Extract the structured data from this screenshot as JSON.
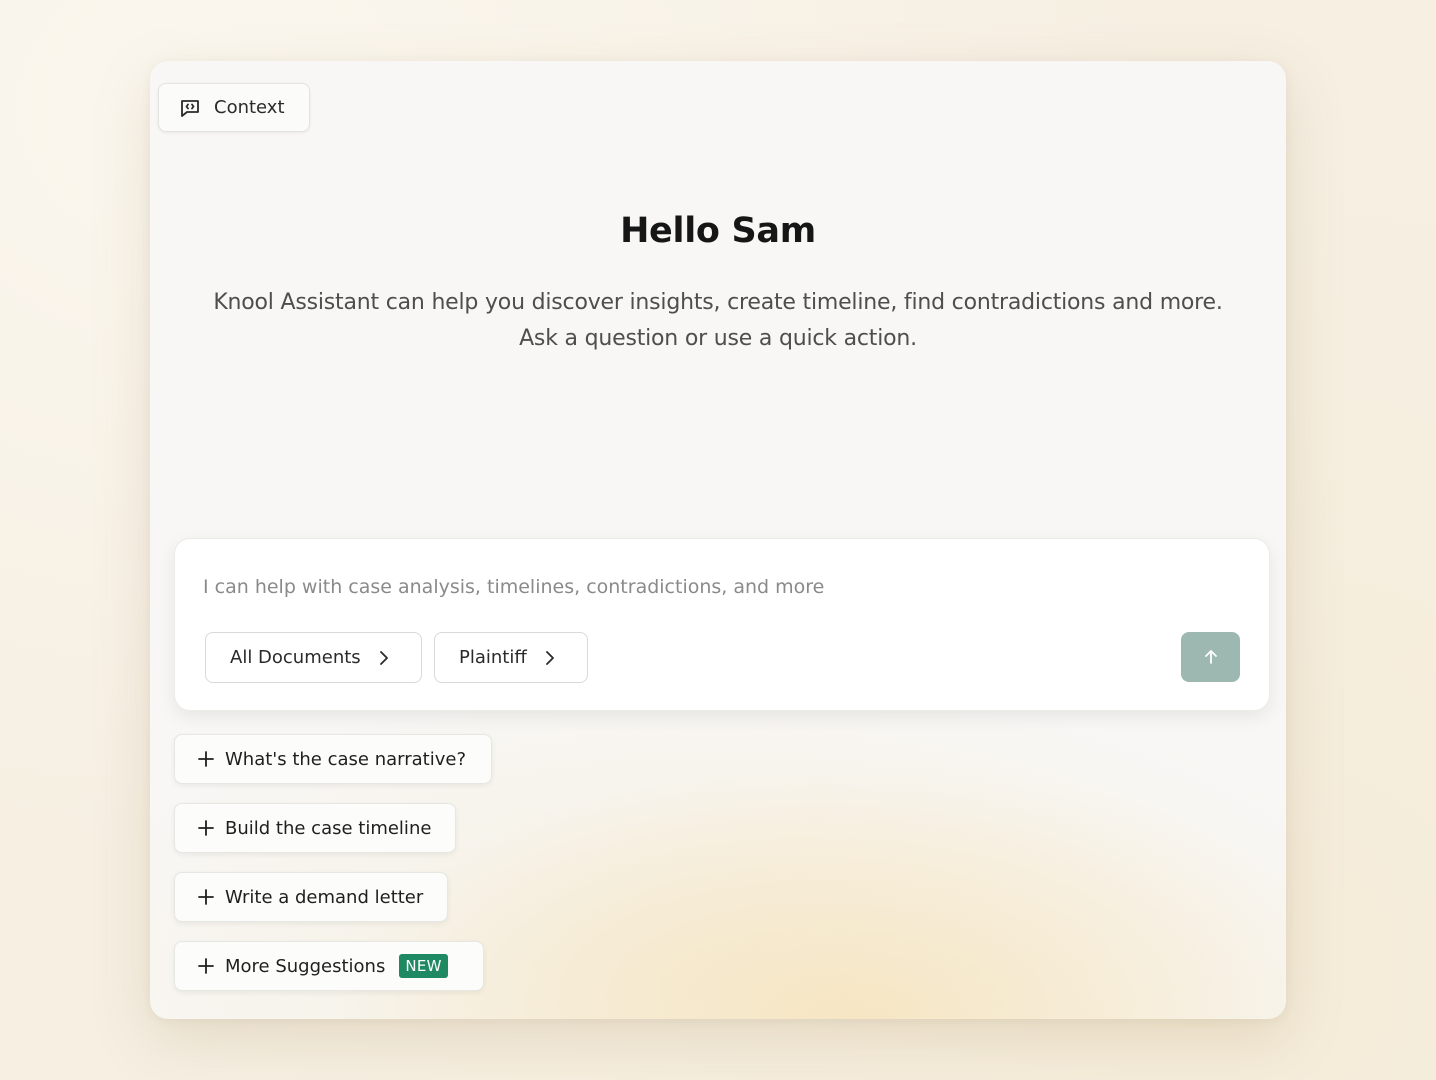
{
  "header": {
    "context_label": "Context"
  },
  "greeting": {
    "title": "Hello Sam",
    "line1": "Knool Assistant can help you discover insights, create timeline, find contradictions and more.",
    "line2": "Ask a question or use a quick action."
  },
  "composer": {
    "placeholder": "I can help with case analysis, timelines, contradictions, and more",
    "chips": [
      {
        "label": "All Documents"
      },
      {
        "label": "Plaintiff"
      }
    ],
    "send_icon": "arrow-up-icon"
  },
  "suggestions": [
    {
      "label": "What's the case narrative?"
    },
    {
      "label": "Build the case timeline"
    },
    {
      "label": "Write a demand letter"
    },
    {
      "label": "More Suggestions",
      "badge": "NEW"
    }
  ],
  "colors": {
    "accent_send": "#9cb8b0",
    "badge": "#1f8a62"
  }
}
